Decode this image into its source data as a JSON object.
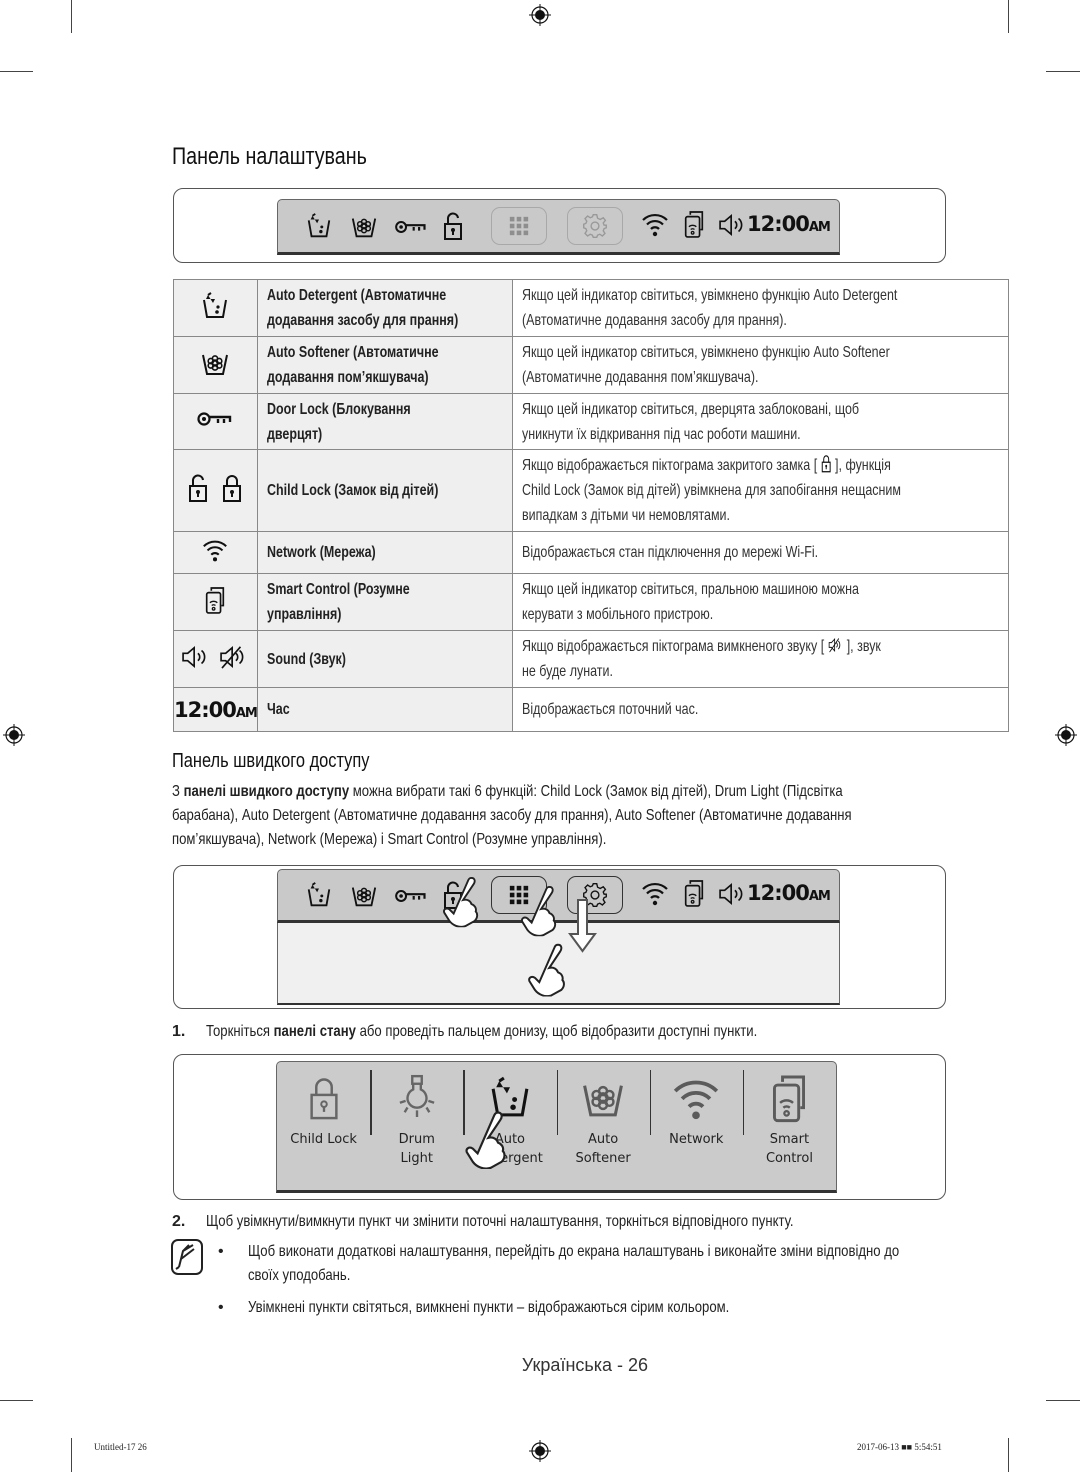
{
  "page": {
    "title": "Панель налаштувань",
    "footer_label": "Українська - 26",
    "slug_left": "Untitled-17   26",
    "slug_right": "2017-06-13   ■■ 5:54:51"
  },
  "status_bar": {
    "icons": [
      "auto-detergent-icon",
      "auto-softener-icon",
      "door-lock-icon",
      "child-lock-open-icon",
      "quick-panel-grid-button",
      "settings-gear-button",
      "wifi-icon",
      "smart-control-icon",
      "sound-on-icon"
    ],
    "clock": "12:00",
    "clock_suffix": "AM"
  },
  "indicator_table": {
    "rows": [
      {
        "icon": "auto-detergent-icon",
        "name": "Auto Detergent (Автоматичне додавання засобу для прання)",
        "name_lines": [
          "Auto Detergent (Автоматичне",
          "додавання засобу для прання)"
        ],
        "desc_lines": [
          "Якщо цей індикатор світиться, увімкнено функцію Auto Detergent",
          "(Автоматичне додавання засобу для прання)."
        ]
      },
      {
        "icon": "auto-softener-icon",
        "name_lines": [
          "Auto Softener (Автоматичне",
          "додавання пом’якшувача)"
        ],
        "desc_lines": [
          "Якщо цей індикатор світиться, увімкнено функцію Auto Softener",
          "(Автоматичне додавання пом’якшувача)."
        ]
      },
      {
        "icon": "door-lock-icon",
        "name_lines": [
          "Door Lock (Блокування",
          "дверцят)"
        ],
        "desc_lines": [
          "Якщо цей індикатор світиться, дверцята заблоковані, щоб",
          "уникнути їх відкривання під час роботи машини."
        ]
      },
      {
        "icon": "child-lock-icons",
        "name_lines": [
          "Child Lock (Замок від дітей)"
        ],
        "desc_lines": [
          "Якщо відображається піктограма закритого замка [",
          "], функція",
          "Child Lock (Замок від дітей) увімкнена для запобігання нещасним",
          "випадкам з дітьми чи немовлятами."
        ]
      },
      {
        "icon": "wifi-icon",
        "name_lines": [
          "Network (Мережа)"
        ],
        "desc_lines": [
          "Відображається стан підключення до мережі Wi-Fi."
        ]
      },
      {
        "icon": "smart-control-icon",
        "name_lines": [
          "Smart Control (Розумне",
          "управління)"
        ],
        "desc_lines": [
          "Якщо цей індикатор світиться, пральною машиною можна",
          "керувати з мобільного пристрою."
        ]
      },
      {
        "icon": "sound-icons",
        "name_lines": [
          "Sound (Звук)"
        ],
        "desc_lines": [
          "Якщо відображається піктограма вимкненого звуку [",
          "], звук",
          "не буде лунати."
        ]
      },
      {
        "icon": "clock-display",
        "icon_text": "12:00",
        "icon_suffix": "AM",
        "name_lines": [
          "Час"
        ],
        "desc_lines": [
          "Відображається поточний час."
        ]
      }
    ]
  },
  "quick_access": {
    "title": "Панель швидкого доступу",
    "intro_prefix": "З ",
    "intro_bold": "панелі швидкого доступу",
    "intro_line1_rest": " можна вибрати такі 6 функцій: Child Lock (Замок від дітей), Drum Light (Підсвітка",
    "intro_line2": "барабана), Auto Detergent (Автоматичне додавання засобу для прання), Auto Softener (Автоматичне додавання",
    "intro_line3": "пом’якшувача), Network (Мережа) і Smart Control (Розумне управління).",
    "step1": {
      "num": "1.",
      "prefix": "Торкніться ",
      "bold": "панелі стану",
      "rest": " або проведіть пальцем донизу, щоб відобразити доступні пункти."
    },
    "items": [
      {
        "icon": "child-lock-icon",
        "label_lines": [
          "Child Lock"
        ]
      },
      {
        "icon": "drum-light-icon",
        "label_lines": [
          "Drum",
          "Light"
        ]
      },
      {
        "icon": "auto-detergent-icon",
        "label_lines": [
          "Auto",
          "Detergent"
        ]
      },
      {
        "icon": "auto-softener-icon",
        "label_lines": [
          "Auto",
          "Softener"
        ]
      },
      {
        "icon": "network-icon",
        "label_lines": [
          "Network"
        ]
      },
      {
        "icon": "smart-control-icon",
        "label_lines": [
          "Smart",
          "Control"
        ]
      }
    ],
    "step2": {
      "num": "2.",
      "text": "Щоб увімкнути/вимкнути пункт чи змінити поточні налаштування, торкніться відповідного пункту."
    },
    "notes": [
      {
        "bullet": "•",
        "lines": [
          "Щоб виконати додаткові налаштування, перейдіть до екрана налаштувань і виконайте зміни відповідно до",
          "своїх уподобань."
        ]
      },
      {
        "bullet": "•",
        "lines": [
          "Увімкнені пункти світяться, вимкнені пункти – відображаються сірим кольором."
        ]
      }
    ]
  },
  "colors": {
    "panel_gray": "#c9c9c9",
    "table_shade": "#efefef",
    "border": "#888888"
  }
}
